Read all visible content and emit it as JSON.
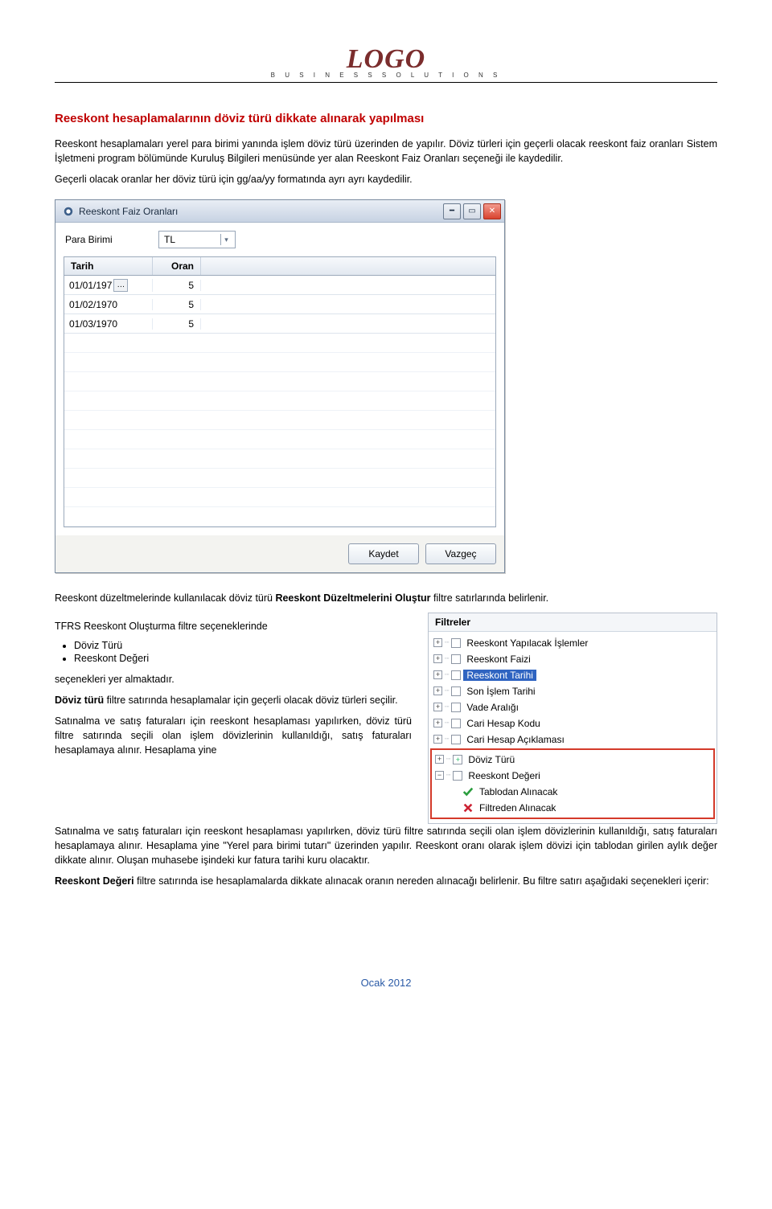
{
  "header": {
    "logo_text": "LOGO",
    "tagline": "B U S I N E S S   S O L U T I O N S"
  },
  "headings": {
    "h1": "Reeskont hesaplamalarının döviz türü dikkate alınarak yapılması"
  },
  "paragraphs": {
    "p1": "Reeskont hesaplamaları yerel para birimi yanında işlem döviz türü üzerinden de yapılır. Döviz türleri için geçerli olacak reeskont faiz oranları Sistem İşletmeni program bölümünde Kuruluş Bilgileri menüsünde yer alan Reeskont Faiz Oranları seçeneği ile kaydedilir.",
    "p2": "Geçerli olacak oranlar her döviz türü için gg/aa/yy formatında ayrı ayrı kaydedilir.",
    "p3_pre": "Reeskont düzeltmelerinde kullanılacak döviz türü ",
    "p3_bold": "Reeskont Düzeltmelerini Oluştur",
    "p3_post": " filtre satırlarında belirlenir.",
    "p4": "TFRS Reeskont Oluşturma filtre seçeneklerinde",
    "bullets": [
      "Döviz Türü",
      "Reeskont Değeri"
    ],
    "p5": "seçenekleri yer almaktadır.",
    "p6_bold": "Döviz türü",
    "p6_rest": " filtre satırında hesaplamalar için geçerli olacak döviz türleri seçilir.",
    "p7": "Satınalma ve satış faturaları için reeskont hesaplaması yapılırken, döviz türü filtre satırında seçili olan işlem dövizlerinin kullanıldığı, satış faturaları hesaplamaya alınır. Hesaplama yine \"Yerel para birimi tutarı\" üzerinden yapılır. Reeskont oranı olarak işlem dövizi için tablodan girilen aylık değer dikkate alınır. Oluşan muhasebe işindeki kur fatura tarihi kuru olacaktır.",
    "p8_bold": "Reeskont Değeri",
    "p8_rest": " filtre satırında ise hesaplamalarda dikkate alınacak oranın nereden alınacağı belirlenir. Bu filtre satırı aşağıdaki seçenekleri içerir:"
  },
  "dialog": {
    "title": "Reeskont Faiz Oranları",
    "para_label": "Para Birimi",
    "para_value": "TL",
    "col_tarih": "Tarih",
    "col_oran": "Oran",
    "rows": [
      {
        "tarih": "01/01/197",
        "oran": "5",
        "editing": true
      },
      {
        "tarih": "01/02/1970",
        "oran": "5",
        "editing": false
      },
      {
        "tarih": "01/03/1970",
        "oran": "5",
        "editing": false
      }
    ],
    "btn_save": "Kaydet",
    "btn_cancel": "Vazgeç"
  },
  "filter_panel": {
    "heading": "Filtreler",
    "items": [
      {
        "label": "Reeskont Yapılacak İşlemler",
        "state": "plus"
      },
      {
        "label": "Reeskont Faizi",
        "state": "plus"
      },
      {
        "label": "Reeskont Tarihi",
        "state": "plus",
        "selected": true
      },
      {
        "label": "Son İşlem Tarihi",
        "state": "plus"
      },
      {
        "label": "Vade Aralığı",
        "state": "plus"
      },
      {
        "label": "Cari Hesap Kodu",
        "state": "plus"
      },
      {
        "label": "Cari Hesap Açıklaması",
        "state": "plus"
      }
    ],
    "highlighted": {
      "parents": [
        {
          "label": "Döviz Türü",
          "state": "plus-green"
        },
        {
          "label": "Reeskont Değeri",
          "state": "minus"
        }
      ],
      "children": [
        {
          "label": "Tablodan Alınacak",
          "check": "green"
        },
        {
          "label": "Filtreden Alınacak",
          "check": "red"
        }
      ]
    }
  },
  "footer": "Ocak 2012"
}
